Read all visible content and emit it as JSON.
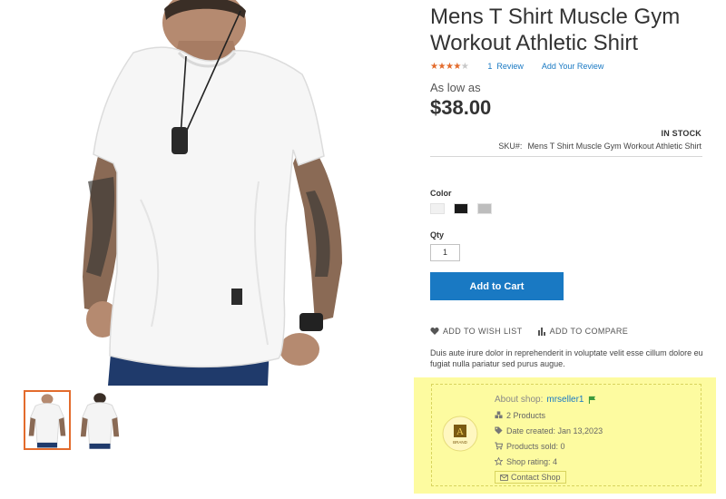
{
  "product": {
    "title": "Mens T Shirt Muscle Gym Workout Athletic Shirt",
    "rating_stars": 4.5,
    "review_count": "1",
    "review_word": "Review",
    "add_review": "Add Your Review",
    "as_low_as": "As low as",
    "price": "$38.00",
    "stock_status": "IN STOCK",
    "sku_label": "SKU#:",
    "sku_value": "Mens T Shirt Muscle Gym Workout Athletic Shirt"
  },
  "options": {
    "color_label": "Color",
    "swatches": [
      {
        "name": "white",
        "color": "#f1f1f1"
      },
      {
        "name": "black",
        "color": "#1a1a1a"
      },
      {
        "name": "gray",
        "color": "#bdbdbd"
      }
    ],
    "qty_label": "Qty",
    "qty_value": "1"
  },
  "actions": {
    "add_to_cart": "Add to Cart",
    "wishlist": "ADD TO WISH LIST",
    "compare": "ADD TO COMPARE"
  },
  "description": "Duis aute irure dolor in reprehenderit in voluptate velit esse cillum dolore eu fugiat nulla pariatur sed purus augue.",
  "shop": {
    "about_label": "About shop:",
    "seller_name": "mrseller1",
    "products": "2 Products",
    "date_created": "Date created: Jan 13,2023",
    "products_sold": "Products sold: 0",
    "shop_rating": "Shop rating: 4",
    "contact_label": "Contact Shop",
    "logo_letter": "A",
    "logo_text": "BRAND"
  },
  "colors": {
    "accent": "#1979c3",
    "star": "#e36b2c",
    "highlight": "#fdfba0",
    "flag": "#3c9a3c"
  }
}
